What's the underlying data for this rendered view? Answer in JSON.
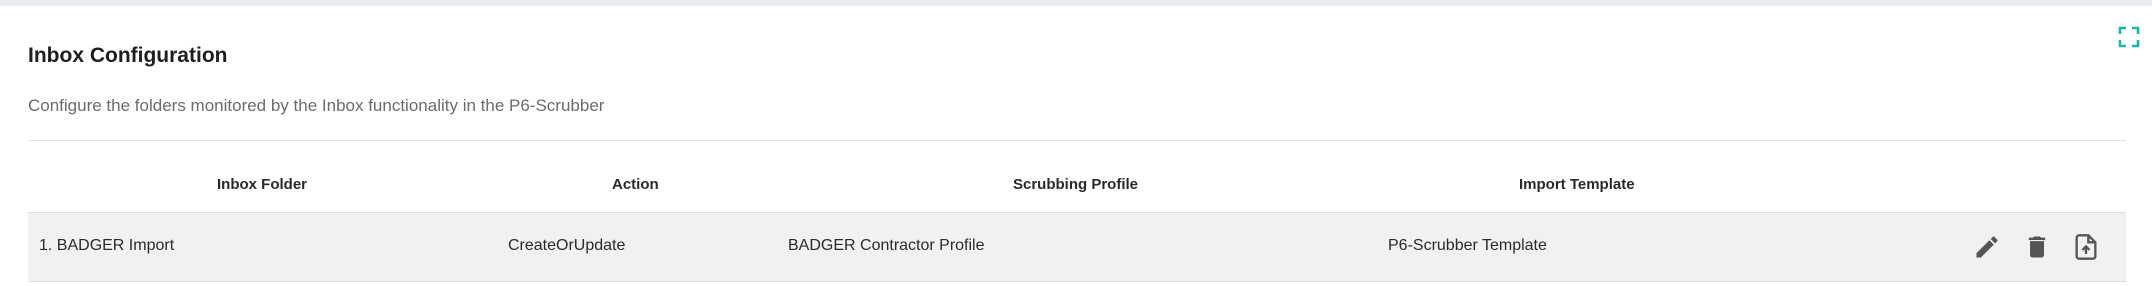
{
  "header": {
    "title": "Inbox Configuration",
    "description": "Configure the folders monitored by the Inbox functionality in the P6-Scrubber"
  },
  "toolbar": {
    "expand_icon": "fullscreen-icon"
  },
  "colors": {
    "accent": "#1fb5a8",
    "row_background": "#f1f1f1",
    "icon": "#555555"
  },
  "table": {
    "columns": [
      "Inbox Folder",
      "Action",
      "Scrubbing Profile",
      "Import Template"
    ],
    "rows": [
      {
        "folder": "1. BADGER Import",
        "action": "CreateOrUpdate",
        "profile": "BADGER Contractor Profile",
        "template": "P6-Scrubber Template",
        "actions": [
          "edit-icon",
          "delete-icon",
          "file-upload-icon"
        ]
      }
    ]
  }
}
